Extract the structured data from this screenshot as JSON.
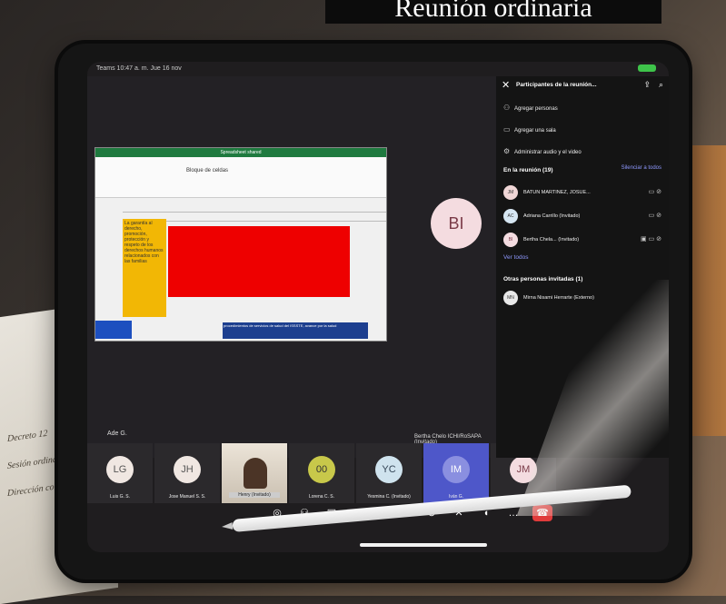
{
  "banner": {
    "title": "Reunión ordinaria"
  },
  "status": {
    "left": "Teams  10:47 a. m.  Jue 16 nov"
  },
  "share": {
    "ribbon": "Spreadsheet shared",
    "toolbar_text": "Bloque de celdas",
    "yellow_text": "La garantía al derecho, promoción, protección y respeto de los derechos humanos relacionados con las familias",
    "blue_text": "procedimientos de servicios de salud del ISSSTE, avance por la salud"
  },
  "stage": {
    "avatar_initials": "BI",
    "big_label": "Bertha Chelo ICHI/RoSAPA (Invitado)",
    "small_label": "Ade G."
  },
  "strip": [
    {
      "initials": "LG",
      "name": "Luis G. S."
    },
    {
      "initials": "JH",
      "name": "Jose Manuel S. S."
    },
    {
      "initials": "",
      "name": "Henry (Invitado)",
      "video": true
    },
    {
      "initials": "00",
      "name": "Lorena C. S."
    },
    {
      "initials": "YC",
      "name": "Yesmina C. (Invitado)"
    },
    {
      "initials": "IM",
      "name": "Iván G.",
      "active": true
    },
    {
      "initials": "JM",
      "name": ""
    }
  ],
  "controls": [
    "camera-icon",
    "people-icon",
    "share-icon",
    "reactions-icon",
    "more-icon",
    "video-off-icon",
    "mic-off-icon",
    "speaker-icon",
    "ellipsis-icon",
    "hangup-icon"
  ],
  "panel": {
    "title": "Participantes de la reunión...",
    "add_people": "Agregar personas",
    "add_room": "Agregar una sala",
    "audio_video": "Administrar audio y el video",
    "in_meeting": "En la reunión (19)",
    "mute_all": "Silenciar a todos",
    "participants": [
      {
        "initials": "JM",
        "name": "BATUN MARTINEZ, JOSUE..."
      },
      {
        "initials": "AC",
        "name": "Adriana Carrillo  (Invitado)"
      },
      {
        "initials": "BI",
        "name": "Bertha Chela...  (Invitado)"
      }
    ],
    "see_all": "Ver todos",
    "others_invited": "Otras personas invitadas (1)",
    "invited": [
      {
        "initials": "MN",
        "name": "Mirna Nisami Herrarte (Externo)"
      }
    ]
  },
  "colors": {
    "accent": "#4e57c9",
    "link": "#8f99ff",
    "hangup": "#e03b3b"
  }
}
